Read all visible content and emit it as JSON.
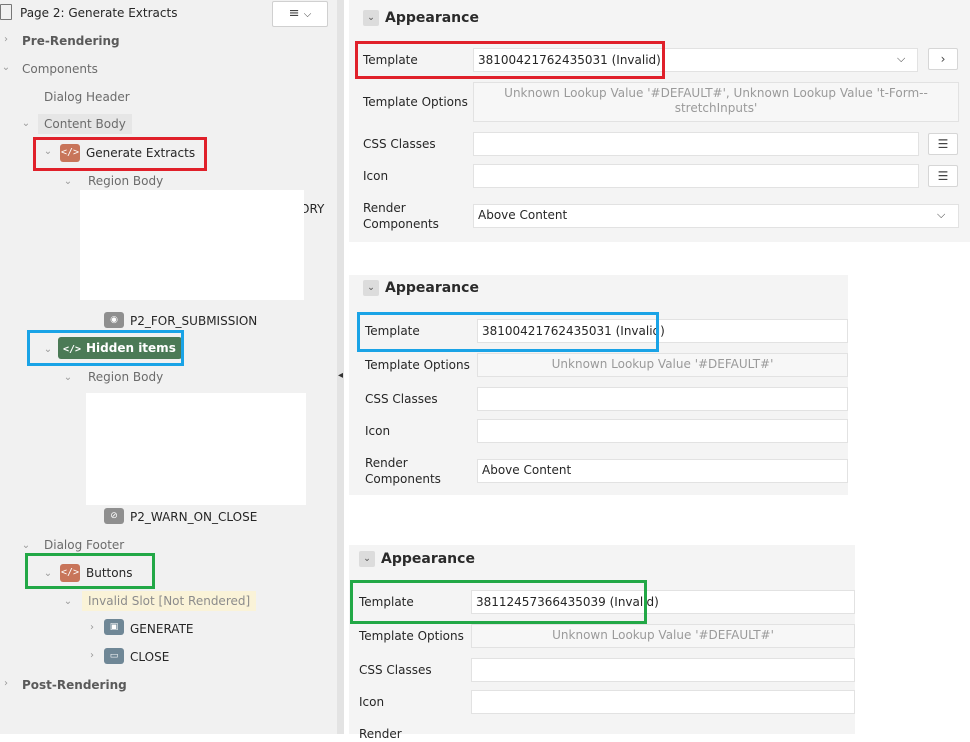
{
  "tree": {
    "page_title": "Page 2: Generate Extracts",
    "menu_icon": "hamburger-icon",
    "pre_rendering": "Pre-Rendering",
    "components": "Components",
    "dialog_header": "Dialog Header",
    "content_body": "Content Body",
    "generate_extracts": "Generate Extracts",
    "region_body_1": "Region Body",
    "partial_text": "ORY",
    "p2_for_submission": "P2_FOR_SUBMISSION",
    "hidden_items": "Hidden items",
    "region_body_2": "Region Body",
    "p2_warn_on_close": "P2_WARN_ON_CLOSE",
    "dialog_footer": "Dialog Footer",
    "buttons": "Buttons",
    "invalid_slot": "Invalid Slot [Not Rendered]",
    "generate": "GENERATE",
    "close": "CLOSE",
    "post_rendering": "Post-Rendering"
  },
  "panel1": {
    "section": "Appearance",
    "template_label": "Template",
    "template_value": "38100421762435031 (Invalid)",
    "template_options_label": "Template Options",
    "template_options_value": "Unknown Lookup Value '#DEFAULT#', Unknown Lookup Value 't-Form--stretchInputs'",
    "css_classes_label": "CSS Classes",
    "css_classes_value": "",
    "icon_label": "Icon",
    "icon_value": "",
    "render_label": "Render Components",
    "render_value": "Above Content"
  },
  "panel2": {
    "section": "Appearance",
    "template_label": "Template",
    "template_value": "38100421762435031 (Invalid)",
    "template_options_label": "Template Options",
    "template_options_value": "Unknown Lookup Value '#DEFAULT#'",
    "css_classes_label": "CSS Classes",
    "icon_label": "Icon",
    "render_label": "Render Components",
    "render_value": "Above Content"
  },
  "panel3": {
    "section": "Appearance",
    "template_label": "Template",
    "template_value": "38112457366435039 (Invalid)",
    "template_options_label": "Template Options",
    "template_options_value": "Unknown Lookup Value '#DEFAULT#'",
    "css_classes_label": "CSS Classes",
    "icon_label": "Icon",
    "render_label": "Render"
  },
  "colors": {
    "highlight_red": "#e0202a",
    "highlight_blue": "#1aa3e6",
    "highlight_green": "#22a846",
    "region_icon": "#c8755a",
    "hidden_items_pill": "#4b7a56"
  }
}
